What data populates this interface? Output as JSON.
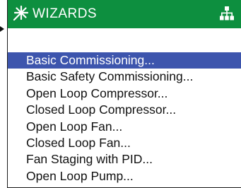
{
  "header": {
    "title": "WIZARDS",
    "icon_left": "wizard-star-icon",
    "icon_right": "tree-hierarchy-icon",
    "background_color": "#0d8f3f"
  },
  "menu": {
    "selected_color": "#3d55ad",
    "items": [
      {
        "label": "Basic Commissioning...",
        "selected": true
      },
      {
        "label": "Basic Safety Commissioning...",
        "selected": false
      },
      {
        "label": "Open Loop Compressor...",
        "selected": false
      },
      {
        "label": "Closed Loop Compressor...",
        "selected": false
      },
      {
        "label": "Open Loop Fan...",
        "selected": false
      },
      {
        "label": "Closed Loop Fan...",
        "selected": false
      },
      {
        "label": "Fan Staging with PID...",
        "selected": false
      },
      {
        "label": "Open Loop Pump...",
        "selected": false
      }
    ]
  }
}
